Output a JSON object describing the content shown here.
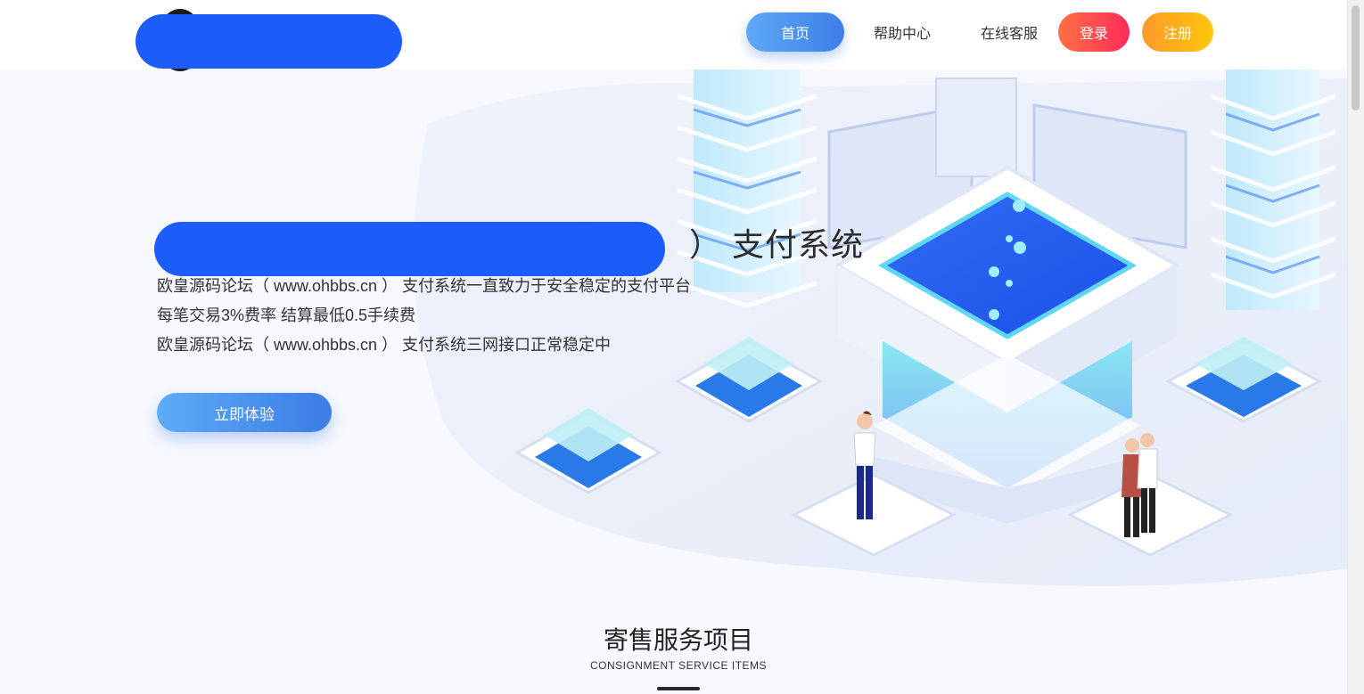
{
  "nav": {
    "home": "首页",
    "help": "帮助中心",
    "service": "在线客服",
    "login": "登录",
    "register": "注册"
  },
  "hero": {
    "title_suffix": "） 支付系统",
    "line1": "欧皇源码论坛（ www.ohbbs.cn ） 支付系统一直致力于安全稳定的支付平台",
    "line2": "每笔交易3%费率 结算最低0.5手续费",
    "line3": "欧皇源码论坛（ www.ohbbs.cn ） 支付系统三网接口正常稳定中",
    "cta": "立即体验"
  },
  "section": {
    "title": "寄售服务项目",
    "subtitle": "CONSIGNMENT SERVICE ITEMS"
  },
  "colors": {
    "accent_blue": "#3d7ee8",
    "redaction": "#1c5cf8",
    "login_red": "#ff2a5a",
    "register_yellow": "#ffc60a"
  }
}
